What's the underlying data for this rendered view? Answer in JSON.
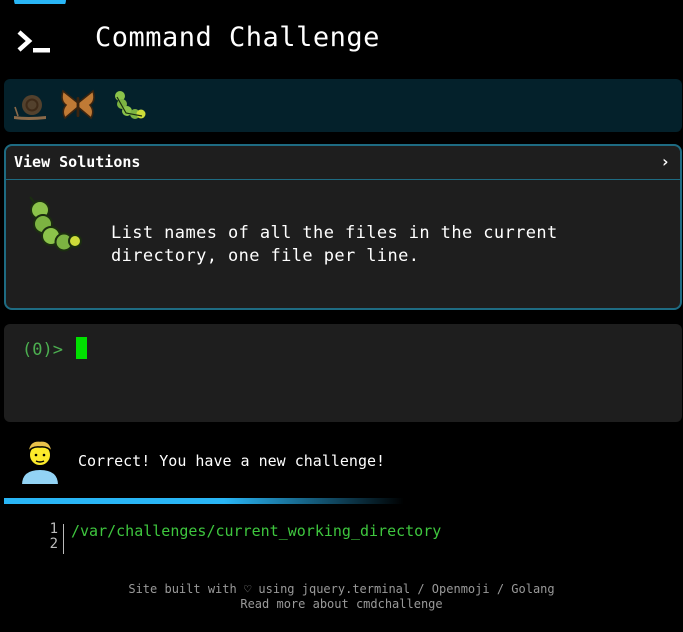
{
  "header": {
    "title": "Command Challenge",
    "logo_icon": "terminal-prompt-icon"
  },
  "badges": [
    {
      "name": "snail-badge-icon"
    },
    {
      "name": "butterfly-badge-icon"
    },
    {
      "name": "caterpillar-badge-icon"
    }
  ],
  "challenge": {
    "toggle_label": "View Solutions",
    "toggle_chevron": "›",
    "icon": "caterpillar-icon",
    "description_line1": "List names of all the files in the current",
    "description_line2": "directory, one file per line."
  },
  "terminal": {
    "prompt": "(0)>"
  },
  "feedback": {
    "avatar_icon": "person-avatar-icon",
    "message": "Correct! You have a new challenge!"
  },
  "editor": {
    "line_numbers": [
      "1",
      "2"
    ],
    "code": "/var/challenges/current_working_directory"
  },
  "footer": {
    "line1": "Site built with ♡ using jquery.terminal / Openmoji / Golang",
    "line2": "Read more about cmdchallenge"
  },
  "colors": {
    "accent": "#29b6f6",
    "prompt_green": "#4caf50",
    "cursor_green": "#00e000",
    "card_border": "#1e6b82"
  }
}
